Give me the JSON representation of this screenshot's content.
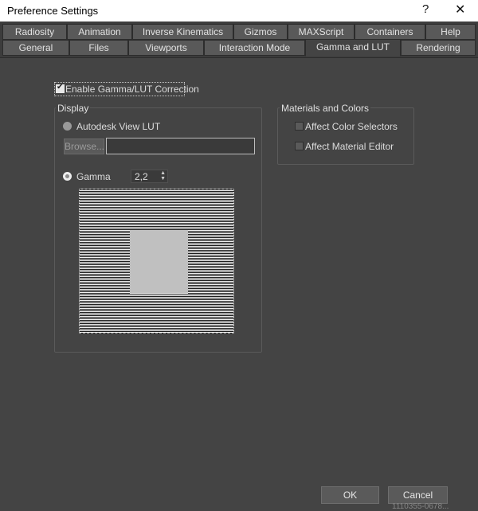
{
  "window": {
    "title": "Preference Settings",
    "help": "?",
    "close": "✕"
  },
  "tabs_row1": [
    "Radiosity",
    "Animation",
    "Inverse Kinematics",
    "Gizmos",
    "MAXScript",
    "Containers",
    "Help"
  ],
  "tabs_row2": [
    "General",
    "Files",
    "Viewports",
    "Interaction Mode",
    "Gamma and LUT",
    "Rendering"
  ],
  "active_tab": "Gamma and LUT",
  "enable": {
    "label": "Enable Gamma/LUT Correction",
    "checked": true
  },
  "display": {
    "title": "Display",
    "autodesk_lut_label": "Autodesk View LUT",
    "browse_label": "Browse...",
    "lut_path": "",
    "gamma_label": "Gamma",
    "gamma_value": "2,2"
  },
  "materials": {
    "title": "Materials and Colors",
    "affect_color_selectors": "Affect Color Selectors",
    "affect_material_editor": "Affect Material Editor"
  },
  "buttons": {
    "ok": "OK",
    "cancel": "Cancel"
  },
  "statusbar": "1110355-0678..."
}
